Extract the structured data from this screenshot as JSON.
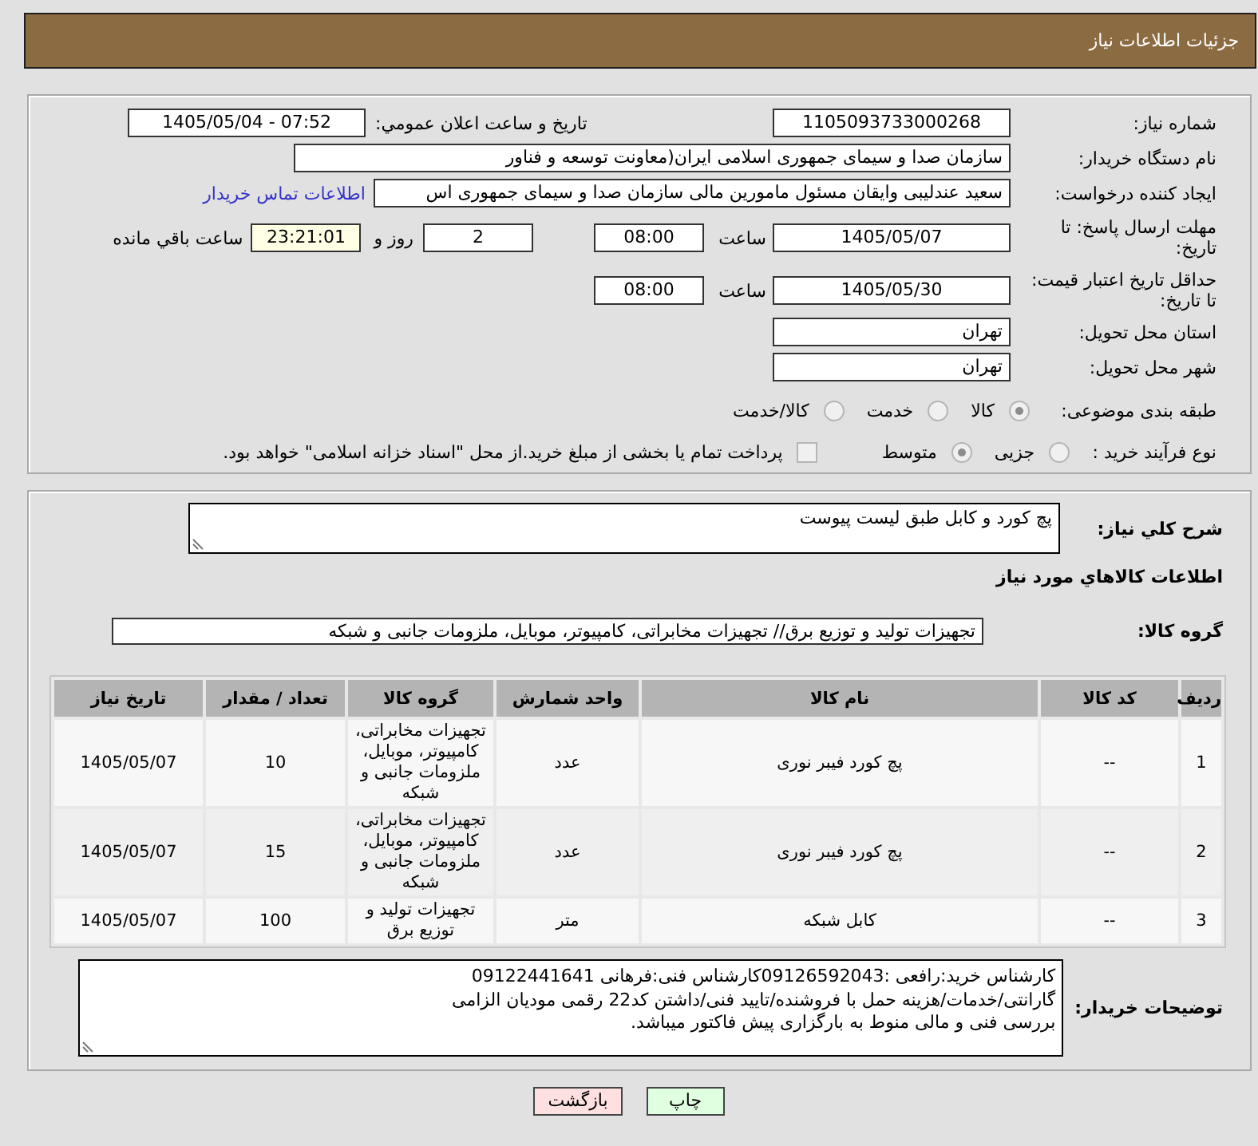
{
  "header": {
    "title": "جزئیات اطلاعات نیاز"
  },
  "details": {
    "need_number": {
      "label": "شماره نیاز:",
      "value": "1105093733000268"
    },
    "announce": {
      "label": "تاریخ و ساعت اعلان عمومي:",
      "value": "1405/05/04 - 07:52"
    },
    "buyer_org": {
      "label": "نام دستگاه خریدار:",
      "value": "سازمان صدا و سیمای جمهوری اسلامی ایران(معاونت توسعه و فناور"
    },
    "creator": {
      "label": "ایجاد کننده درخواست:",
      "value": "سعید عندلیبی وایقان مسئول مامورین مالی  سازمان صدا و سیمای جمهوری اس",
      "link": "اطلاعات تماس خریدار"
    },
    "deadline": {
      "label": "مهلت ارسال پاسخ: تا تاریخ:",
      "date": "1405/05/07",
      "time_label": "ساعت",
      "time": "08:00",
      "days": "2",
      "days_label": "روز و",
      "remaining": "23:21:01",
      "remaining_label": "ساعت باقي مانده"
    },
    "price_validity": {
      "label": "حداقل تاریخ اعتبار قیمت: تا تاریخ:",
      "date": "1405/05/30",
      "time_label": "ساعت",
      "time": "08:00"
    },
    "province": {
      "label": "استان محل تحویل:",
      "value": "تهران"
    },
    "city": {
      "label": "شهر محل تحویل:",
      "value": "تهران"
    },
    "category": {
      "label": "طبقه بندی موضوعی:",
      "options": [
        {
          "label": "کالا",
          "selected": true
        },
        {
          "label": "خدمت",
          "selected": false
        },
        {
          "label": "کالا/خدمت",
          "selected": false
        }
      ]
    },
    "process": {
      "label": "نوع فرآیند خرید :",
      "options": [
        {
          "label": "جزیی",
          "selected": false
        },
        {
          "label": "متوسط",
          "selected": true
        }
      ],
      "treasury": {
        "label": "پرداخت تمام یا بخشی از مبلغ خرید.از محل \"اسناد خزانه اسلامی\" خواهد بود.",
        "checked": false
      }
    }
  },
  "description": {
    "label": "شرح کلي نیاز:",
    "value": "پچ کورد و کابل طبق لیست پیوست"
  },
  "goods_heading": "اطلاعات کالاهاي مورد نیاز",
  "goods_group": {
    "label": "گروه کالا:",
    "value": "تجهیزات تولید و توزیع برق// تجهیزات مخابراتی، کامپیوتر، موبایل، ملزومات جانبی و شبکه"
  },
  "table": {
    "columns": [
      "ردیف",
      "کد کالا",
      "نام کالا",
      "واحد شمارش",
      "گروه کالا",
      "تعداد / مقدار",
      "تاریخ نیاز"
    ],
    "rows": [
      [
        "1",
        "--",
        "پچ کورد فیبر نوری",
        "عدد",
        "تجهیزات مخابراتی، کامپیوتر، موبایل، ملزومات جانبی و شبکه",
        "10",
        "1405/05/07"
      ],
      [
        "2",
        "--",
        "پچ کورد فیبر نوری",
        "عدد",
        "تجهیزات مخابراتی، کامپیوتر، موبایل، ملزومات جانبی و شبکه",
        "15",
        "1405/05/07"
      ],
      [
        "3",
        "--",
        "کابل شبکه",
        "متر",
        "تجهیزات تولید و توزیع برق",
        "100",
        "1405/05/07"
      ]
    ]
  },
  "buyer_notes": {
    "label": "توضیحات خریدار:",
    "value": "کارشناس خرید:رافعی :09126592043کارشناس فنی:فرهانی 09122441641\nگارانتی/خدمات/هزینه حمل با فروشنده/تایید فنی/داشتن کد22 رقمی مودیان الزامی\nبررسی فنی و مالی منوط به بارگزاری پیش فاکتور میباشد."
  },
  "buttons": [
    {
      "label": "چاپ",
      "color": "#e0ffe0"
    },
    {
      "label": "بازگشت",
      "color": "#ffe0e0"
    }
  ]
}
